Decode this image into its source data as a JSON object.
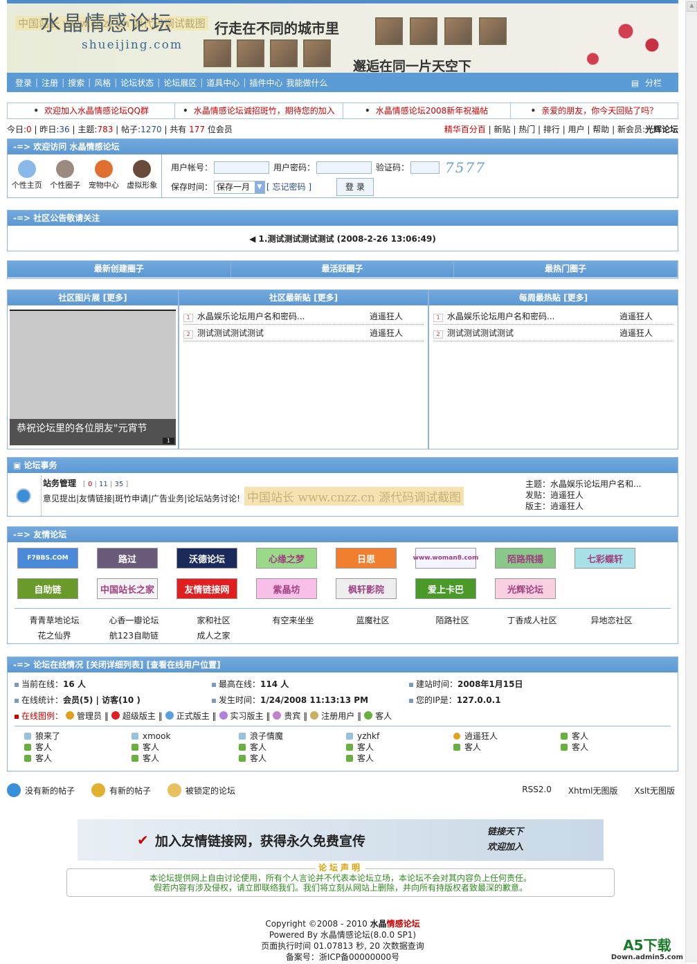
{
  "header": {
    "logo": "水晶情感论坛",
    "watermark": "中国站长 www.cnzz.cn 源代码调试截图",
    "domain": "shueijing.com",
    "slogan1": "行走在不同的城市里",
    "slogan2": "邂逅在同一片天空下"
  },
  "nav": {
    "items": [
      "登录",
      "注册",
      "搜索",
      "风格",
      "论坛状态",
      "论坛展区",
      "道具中心",
      "插件中心",
      "我能做什么"
    ],
    "split": "分栏"
  },
  "notices": [
    "欢迎加入水晶情感论坛QQ群",
    "水晶情感论坛诚招斑竹，期待您的加入",
    "水晶情感论坛2008新年祝福帖",
    "亲爱的朋友，你今天回贴了吗？"
  ],
  "stats": {
    "today_label": "今日:",
    "today": "0",
    "yesterday_label": "| 昨日:",
    "yesterday": "36",
    "topics_label": "| 主题:",
    "topics": "783",
    "posts_label": "| 帖子:",
    "posts": "1270",
    "members_pre": "| 共有",
    "members": "177",
    "members_post": "位会员",
    "right_links": [
      "精华百分百",
      "新贴",
      "热门",
      "排行",
      "用户",
      "帮助"
    ],
    "new_member_label": "新会员:",
    "new_member": "光辉论坛"
  },
  "welcome": {
    "title": "-=> 欢迎访问 水晶情感论坛",
    "icons": [
      "个性主页",
      "个性圈子",
      "宠物中心",
      "虚拟形象"
    ],
    "username_label": "用户帐号：",
    "password_label": "用户密码：",
    "captcha_label": "验证码：",
    "captcha": "7577",
    "save_label": "保存时间：",
    "save_value": "保存一月",
    "forgot": "[ 忘记密码 ]",
    "login_button": "登 录"
  },
  "announce": {
    "title": "-=> 社区公告敬请关注",
    "item": "1.测试测试测试测试 (2008-2-26 13:06:49)"
  },
  "circles": [
    "最新创建圈子",
    "最活跃圈子",
    "最热门圈子"
  ],
  "columns": {
    "pics": {
      "title": "社区图片展 [更多]",
      "caption": "恭祝论坛里的各位朋友\"元宵节",
      "page": "1"
    },
    "latest": {
      "title": "社区最新贴 [更多]",
      "posts": [
        {
          "n": "1",
          "title": "水晶娱乐论坛用户名和密码...",
          "author": "逍遥狂人"
        },
        {
          "n": "2",
          "title": "测试测试测试测试",
          "author": "逍遥狂人"
        }
      ]
    },
    "hot": {
      "title": "每周最热贴 [更多]",
      "posts": [
        {
          "n": "1",
          "title": "水晶娱乐论坛用户名和密码...",
          "author": "逍遥狂人"
        },
        {
          "n": "2",
          "title": "测试测试测试测试",
          "author": "逍遥狂人"
        }
      ]
    }
  },
  "affairs": {
    "title": "论坛事务",
    "forum": "站务管理",
    "counts": [
      "0",
      "11",
      "35"
    ],
    "desc": "意见提出|友情链接|斑竹申请|广告业务|论坛站务讨论!",
    "watermark": "中国站长 www.cnzz.cn 源代码调试截图",
    "topic": "主题：水晶娱乐论坛用户名和...",
    "poster": "发贴：逍遥狂人",
    "moderator": "版主：逍遥狂人"
  },
  "friends": {
    "title": "-=> 友情论坛",
    "logos": [
      {
        "t": "F7BBS.COM",
        "c": "#4a8ad8"
      },
      {
        "t": "路过",
        "c": "#6a5a7a"
      },
      {
        "t": "沃德论坛",
        "c": "#1a2a5a"
      },
      {
        "t": "心缘之梦",
        "c": "#9ad88a"
      },
      {
        "t": "日思",
        "c": "#f08030"
      },
      {
        "t": "www.woman8.com",
        "c": "#f4f4ff"
      },
      {
        "t": "陌路飛揚",
        "c": "#8ac88a"
      },
      {
        "t": "七彩蝶轩",
        "c": "#a8e0e8"
      },
      {
        "t": "自助链",
        "c": "#6a9a2a"
      },
      {
        "t": "中国站长之家",
        "c": "#f4f4f4"
      },
      {
        "t": "友情链接网",
        "c": "#e02020"
      },
      {
        "t": "紫晶坊",
        "c": "#f8c0e8"
      },
      {
        "t": "枫轩影院",
        "c": "#eeeeee"
      },
      {
        "t": "爱上卡巴",
        "c": "#4a9a2a"
      },
      {
        "t": "光辉论坛",
        "c": "#f8d0e0"
      }
    ],
    "links": [
      "青青草地论坛",
      "心香一瓣论坛",
      "家和社区",
      "有空来坐坐",
      "蓝魔社区",
      "陌路社区",
      "丁香成人社区",
      "异地恋社区",
      "花之仙界",
      "航123自助链",
      "成人之家"
    ]
  },
  "online": {
    "title": "-=> 论坛在线情况 [关闭详细列表] [查看在线用户位置]",
    "stats": [
      {
        "l": "当前在线：",
        "v": "16 人"
      },
      {
        "l": "最高在线：",
        "v": "114 人"
      },
      {
        "l": "建站时间：",
        "v": "2008年1月15日"
      },
      {
        "l": "在线统计：",
        "v": "会员(5) | 访客(10 )"
      },
      {
        "l": "发生时间：",
        "v": "1/24/2008 11:13:13 PM"
      },
      {
        "l": "您的IP是：",
        "v": "127.0.0.1"
      }
    ],
    "legend_label": "在线图例：",
    "legend": [
      {
        "t": "管理员",
        "c": "#e0a020"
      },
      {
        "t": "超级版主",
        "c": "#e02020"
      },
      {
        "t": "正式版主",
        "c": "#5aa0e0"
      },
      {
        "t": "实习版主",
        "c": "#b080e0"
      },
      {
        "t": "贵宾",
        "c": "#c080d0"
      },
      {
        "t": "注册用户",
        "c": "#c8b060"
      },
      {
        "t": "客人",
        "c": "#6ab040"
      }
    ],
    "users": [
      "狼来了",
      "xmook",
      "浪子情魔",
      "yzhkf",
      "逍遥狂人",
      "客人",
      "客人",
      "客人",
      "客人",
      "客人",
      "客人",
      "客人",
      "客人",
      "客人",
      "客人",
      "客人"
    ]
  },
  "legendbar": {
    "items": [
      "没有新的帖子",
      "有新的帖子",
      "被锁定的论坛"
    ],
    "links": [
      "RSS2.0",
      "Xhtml无图版",
      "Xslt无图版"
    ]
  },
  "ad": {
    "text": "加入友情链接网，获得永久免费宣传",
    "right1": "链接天下",
    "right2": "欢迎加入"
  },
  "disclaimer": {
    "title": "论坛声明",
    "line1": "本论坛提供网上自由讨论使用，所有个人言论并不代表本论坛立场，本论坛不会对其内容负上任何责任。",
    "line2": "假若内容有涉及侵权，请立即联络我们。我们将立刻从网站上删除，并向所有持版权者致最深的歉意。"
  },
  "footer": {
    "copyright": "Copyright ©2008 - 2010 ",
    "brand1": "水晶",
    "brand2": "情感论坛",
    "powered": "Powered By 水晶情感论坛(8.0.0 SP1)",
    "exec": "页面执行时间 01.07813 秒, 20 次数据查询",
    "icp": "备案号：浙ICP备00000000号"
  },
  "a5": {
    "logo": "A5下载",
    "sub": "Down.admin5.com"
  },
  "colors": {
    "header_blue": "#5b9bd5",
    "border": "#8fb5da",
    "notice_red": "#cc0000",
    "disclaimer_green": "#2f8a1f"
  }
}
